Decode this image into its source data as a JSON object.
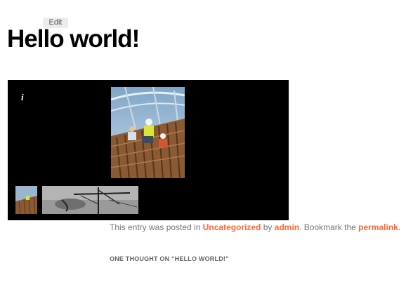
{
  "edit_label": "Edit",
  "post": {
    "title": "Hello world!",
    "meta": {
      "prefix": "This entry was posted in ",
      "category": "Uncategorized",
      "by": " by ",
      "author": "admin",
      "bookmark": ". Bookmark the ",
      "permalink": "permalink",
      "end": "."
    }
  },
  "gallery": {
    "info_label": "i",
    "main_image": "construction-workers-rebar-photo",
    "thumbnails": [
      "construction-site-thumbnail",
      "crane-grayscale-thumbnail"
    ]
  },
  "comments": {
    "title": "ONE THOUGHT ON “HELLO WORLD!”"
  },
  "colors": {
    "link": "#ff6633",
    "gallery_bg": "#000000"
  }
}
